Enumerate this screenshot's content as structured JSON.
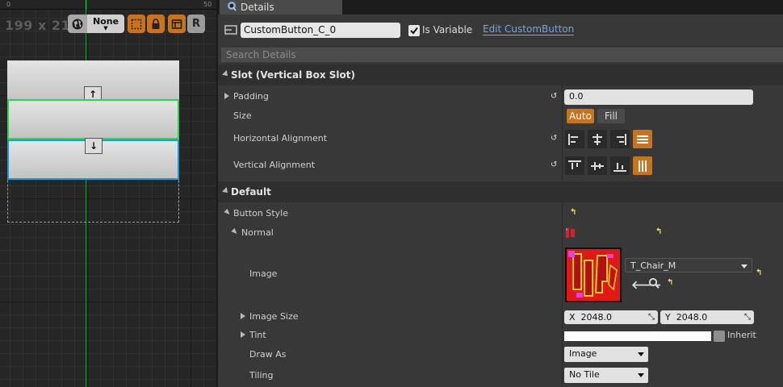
{
  "viewport": {
    "ruler_ticks": [
      "0",
      "50"
    ],
    "size_readout": "199 x 214",
    "screen_size_label": "None",
    "resize_label": "R"
  },
  "panel": {
    "tab_title": "Details",
    "widget_name": "CustomButton_C_0",
    "is_variable_label": "Is Variable",
    "is_variable_checked": true,
    "edit_link": "Edit CustomButton",
    "search_placeholder": "Search Details"
  },
  "slot_section": {
    "title": "Slot (Vertical Box Slot)",
    "padding_label": "Padding",
    "padding_value": "0.0",
    "size_label": "Size",
    "size_auto": "Auto",
    "size_fill": "Fill",
    "h_align_label": "Horizontal Alignment",
    "v_align_label": "Vertical Alignment"
  },
  "default_section": {
    "title": "Default",
    "button_style_label": "Button Style",
    "normal_label": "Normal",
    "image_label": "Image",
    "texture_name": "T_Chair_M",
    "image_size_label": "Image Size",
    "image_size_x_label": "X",
    "image_size_x": "2048.0",
    "image_size_y_label": "Y",
    "image_size_y": "2048.0",
    "tint_label": "Tint",
    "inherit_label": "Inherit",
    "draw_as_label": "Draw As",
    "draw_as_value": "Image",
    "tiling_label": "Tiling",
    "tiling_value": "No Tile"
  },
  "colors": {
    "accent": "#c8731e",
    "link": "#6fa6e8",
    "selection_green": "#2cd84a",
    "selection_blue": "#1d9bd8"
  }
}
